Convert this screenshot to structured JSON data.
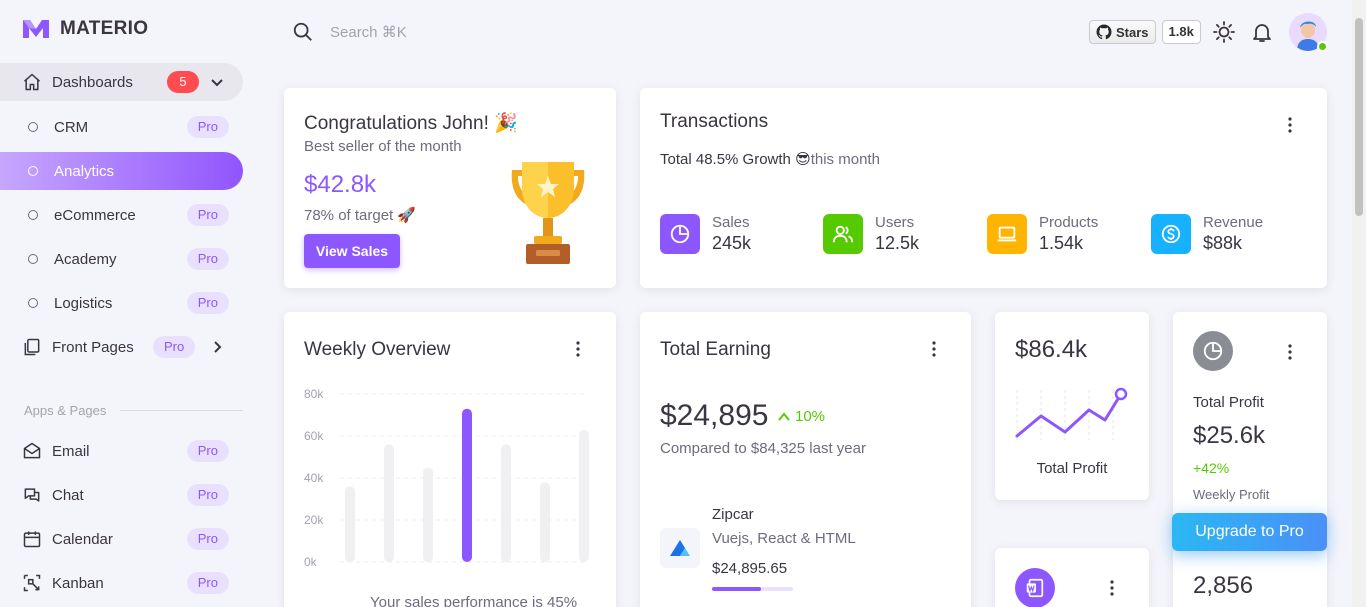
{
  "brand": {
    "name": "MATERIO",
    "color": "#8c57ff"
  },
  "nav": {
    "dashboards": {
      "label": "Dashboards",
      "badge": "5"
    },
    "sub": [
      {
        "label": "CRM",
        "pro": "Pro"
      },
      {
        "label": "Analytics",
        "active": true
      },
      {
        "label": "eCommerce",
        "pro": "Pro"
      },
      {
        "label": "Academy",
        "pro": "Pro"
      },
      {
        "label": "Logistics",
        "pro": "Pro"
      }
    ],
    "front_pages": {
      "label": "Front Pages",
      "pro": "Pro"
    },
    "section": "Apps & Pages",
    "apps": [
      {
        "label": "Email",
        "pro": "Pro",
        "icon": "mail-icon"
      },
      {
        "label": "Chat",
        "pro": "Pro",
        "icon": "chat-icon"
      },
      {
        "label": "Calendar",
        "pro": "Pro",
        "icon": "calendar-icon"
      },
      {
        "label": "Kanban",
        "pro": "Pro",
        "icon": "kanban-icon"
      }
    ]
  },
  "header": {
    "search_placeholder": "Search ⌘K",
    "github": {
      "label": "Stars",
      "count": "1.8k"
    }
  },
  "congrats": {
    "title": "Congratulations John! 🎉",
    "subtitle": "Best seller of the month",
    "amount": "$42.8k",
    "target": "78% of target 🚀",
    "button": "View Sales"
  },
  "transactions": {
    "title": "Transactions",
    "growth_bold": "Total 48.5% Growth",
    "growth_emoji": "😎",
    "growth_rest": "this month",
    "stats": [
      {
        "label": "Sales",
        "value": "245k",
        "color": "#8c57ff",
        "icon": "pie-chart-icon"
      },
      {
        "label": "Users",
        "value": "12.5k",
        "color": "#56ca00",
        "icon": "users-icon"
      },
      {
        "label": "Products",
        "value": "1.54k",
        "color": "#ffb400",
        "icon": "laptop-icon"
      },
      {
        "label": "Revenue",
        "value": "$88k",
        "color": "#16b1ff",
        "icon": "dollar-icon"
      }
    ]
  },
  "weekly": {
    "title": "Weekly Overview",
    "footer": "Your sales performance is 45%"
  },
  "chart_data": {
    "type": "bar",
    "categories": [
      "",
      "",
      "",
      "",
      "",
      "",
      ""
    ],
    "values": [
      36,
      56,
      45,
      73,
      56,
      38,
      63
    ],
    "highlight_index": 3,
    "ylim": [
      0,
      80
    ],
    "yticks": [
      "80k",
      "60k",
      "40k",
      "20k",
      "0k"
    ],
    "grid": true
  },
  "earning": {
    "title": "Total Earning",
    "amount": "$24,895",
    "change": "10%",
    "compare": "Compared to $84,325 last year",
    "item": {
      "name": "Zipcar",
      "desc": "Vuejs, React & HTML",
      "amount": "$24,895.65",
      "progress": 0.6
    }
  },
  "profit_chart": {
    "value": "$86.4k",
    "label": "Total Profit"
  },
  "profit": {
    "title": "Total Profit",
    "value": "$25.6k",
    "change": "+42%",
    "period": "Weekly Profit",
    "bottom_value": "2,856"
  },
  "upgrade": "Upgrade to Pro"
}
